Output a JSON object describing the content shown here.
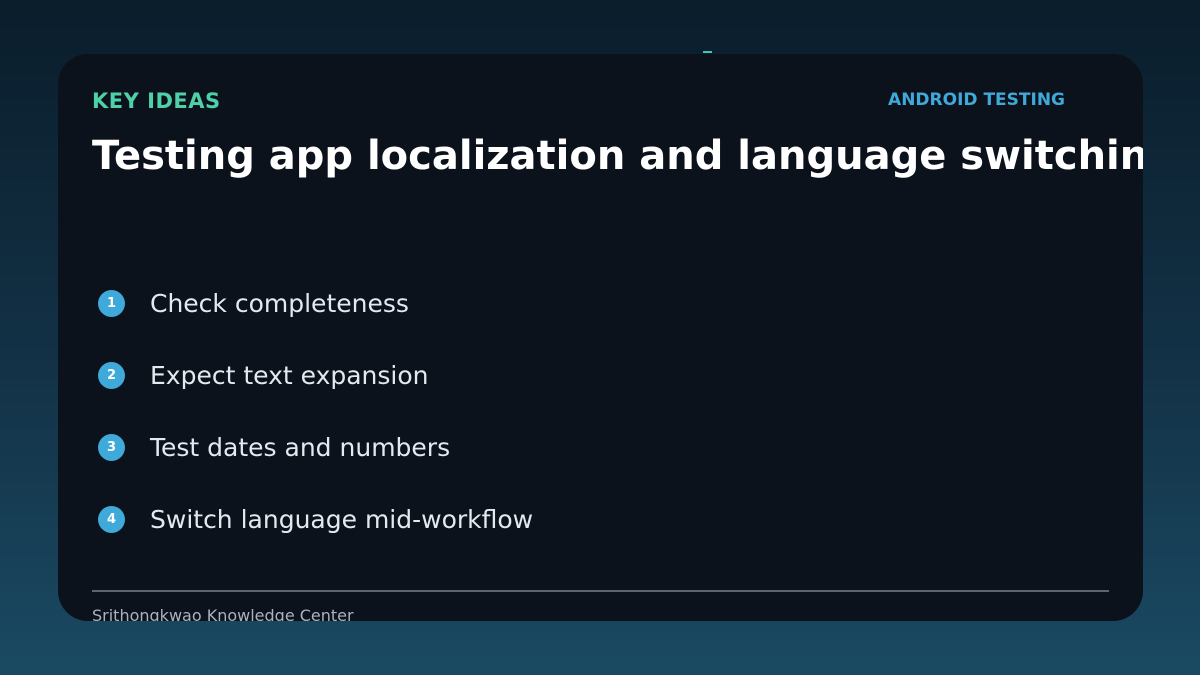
{
  "slide": {
    "kicker": "KEY IDEAS",
    "tag": "ANDROID TESTING",
    "title": "Testing app localization and language switching",
    "points": [
      {
        "number": "1",
        "label": "Check completeness"
      },
      {
        "number": "2",
        "label": "Expect text expansion"
      },
      {
        "number": "3",
        "label": "Test dates and numbers"
      },
      {
        "number": "4",
        "label": "Switch language mid-workflow"
      }
    ],
    "footer": "Srithongkwao Knowledge Center"
  },
  "colors": {
    "kicker": "#4fd1a8",
    "accent": "#3fa9da",
    "card_background": "#0c121b",
    "title": "#ffffff"
  }
}
